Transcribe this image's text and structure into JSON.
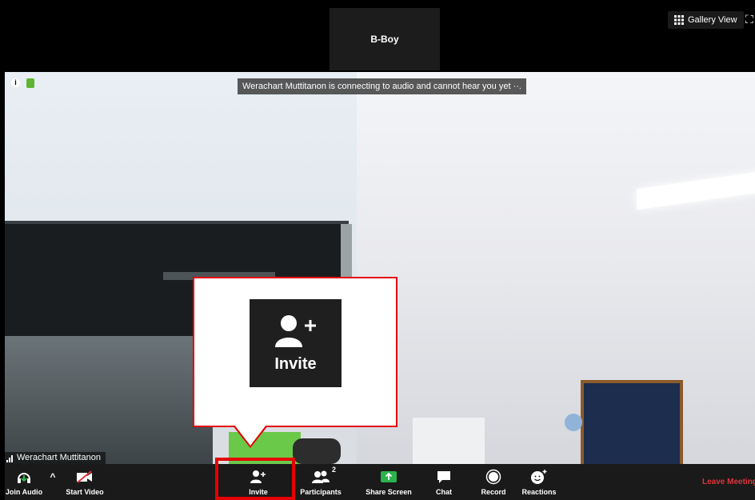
{
  "top": {
    "thumbnail_name": "B-Boy",
    "gallery_view_label": "Gallery View"
  },
  "notice": "Werachart Muttitanon is connecting to audio and cannot hear you yet",
  "participant_name": "Werachart Muttitanon",
  "toolbar": {
    "join_audio": "Join Audio",
    "start_video": "Start Video",
    "invite": "Invite",
    "participants": "Participants",
    "participants_count": "2",
    "share_screen": "Share Screen",
    "chat": "Chat",
    "record": "Record",
    "reactions": "Reactions",
    "leave_meeting": "Leave Meeting"
  },
  "callout": {
    "label": "Invite"
  },
  "colors": {
    "highlight": "#e50000",
    "share_green": "#2bb24c",
    "leave_red": "#e0353b"
  }
}
